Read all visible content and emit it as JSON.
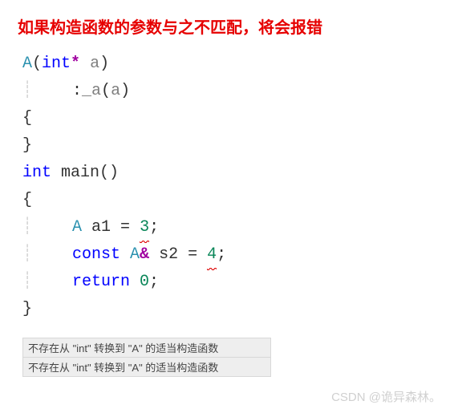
{
  "header": "如果构造函数的参数与之不匹配，将会报错",
  "code": {
    "ctor_name": "A",
    "param_type_prefix": "int",
    "pointer": "*",
    "param_name": "a",
    "init_colon": ":",
    "member_name": "_a",
    "init_arg": "a",
    "brace_open": "{",
    "brace_close": "}",
    "main_type": "int",
    "main_name": " main",
    "main_parens": "()",
    "stmt1_type": "A",
    "stmt1_var": " a1 ",
    "stmt1_eq": "= ",
    "stmt1_val": "3",
    "semicolon": ";",
    "stmt2_const": "const",
    "stmt2_type": " A",
    "stmt2_ref": "&",
    "stmt2_var": " s2 ",
    "stmt2_eq": "= ",
    "stmt2_val": "4",
    "return_kw": "return",
    "return_val": " 0"
  },
  "errors": {
    "e1": "不存在从 \"int\" 转换到 \"A\" 的适当构造函数",
    "e2": "不存在从 \"int\" 转换到 \"A\" 的适当构造函数"
  },
  "watermark": "CSDN @诡异森林。"
}
